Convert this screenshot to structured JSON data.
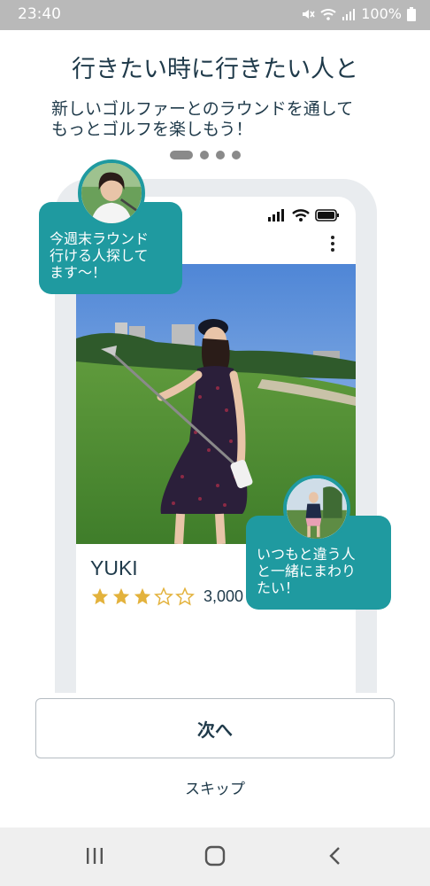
{
  "status_bar": {
    "time": "23:40",
    "battery": "100%",
    "icons": [
      "mute-icon",
      "wifi-icon",
      "signal-icon",
      "battery-icon"
    ]
  },
  "onboarding": {
    "headline": "行きたい時に行きたい人と",
    "subline_1": "新しいゴルファーとのラウンドを通して",
    "subline_2": "もっとゴルフを楽しもう！",
    "page_indicator": {
      "current": 1,
      "total": 4
    }
  },
  "mock_profile": {
    "name": "YUKI",
    "rating": 3,
    "rating_max": 5,
    "score": "3,000"
  },
  "bubbles": {
    "left_line_1": "今週末ラウンド",
    "left_line_2": "行ける人探して",
    "left_line_3": "ます〜！",
    "right_line_1": "いつもと違う人",
    "right_line_2": "と一緒にまわり",
    "right_line_3": "たい！"
  },
  "actions": {
    "next_label": "次へ",
    "skip_label": "スキップ"
  },
  "colors": {
    "accent": "#1f9aa0",
    "text": "#1f3a4a",
    "star": "#e3b23c",
    "status_bar": "#b9b9b9"
  },
  "nav_bar": {
    "icons": [
      "recent-apps-icon",
      "home-icon",
      "back-icon"
    ]
  }
}
